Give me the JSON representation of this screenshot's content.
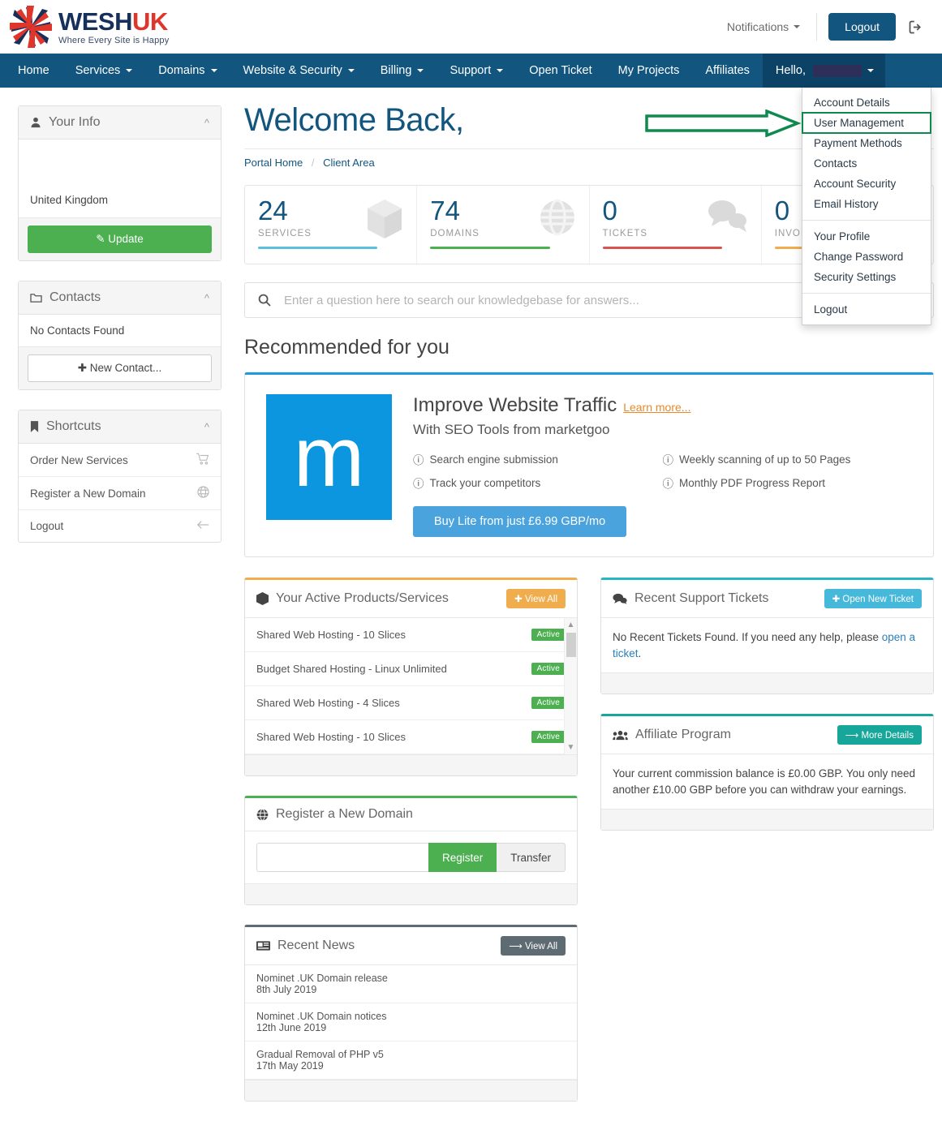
{
  "brand": {
    "name_main": "WESH",
    "name_accent": "UK",
    "tagline": "Where Every Site is Happy",
    "color_navy": "#16305c",
    "color_red": "#e0352b"
  },
  "header": {
    "notifications_label": "Notifications",
    "logout_label": "Logout",
    "logout_icon": "sign-out-icon"
  },
  "nav": {
    "items": [
      {
        "label": "Home",
        "caret": false
      },
      {
        "label": "Services",
        "caret": true
      },
      {
        "label": "Domains",
        "caret": true
      },
      {
        "label": "Website & Security",
        "caret": true
      },
      {
        "label": "Billing",
        "caret": true
      },
      {
        "label": "Support",
        "caret": true
      },
      {
        "label": "Open Ticket",
        "caret": false
      },
      {
        "label": "My Projects",
        "caret": false
      },
      {
        "label": "Affiliates",
        "caret": false
      }
    ],
    "user_label": "Hello,",
    "user_name_redacted": true,
    "accent": "#12557e",
    "accent_active": "#0c4265"
  },
  "user_dropdown": {
    "group1": [
      "Account Details",
      "User Management",
      "Payment Methods",
      "Contacts",
      "Account Security",
      "Email History"
    ],
    "group2": [
      "Your Profile",
      "Change Password",
      "Security Settings"
    ],
    "group3": [
      "Logout"
    ],
    "highlighted": "User Management",
    "annotation_color": "#0f8a4f"
  },
  "page": {
    "welcome": "Welcome Back,",
    "breadcrumb": {
      "home": "Portal Home",
      "sep": "/",
      "current": "Client Area"
    }
  },
  "stats": [
    {
      "value": "24",
      "label": "SERVICES",
      "color": "#5bc0de",
      "icon": "box-icon"
    },
    {
      "value": "74",
      "label": "DOMAINS",
      "color": "#4caf50",
      "icon": "globe-icon"
    },
    {
      "value": "0",
      "label": "TICKETS",
      "color": "#d9534f",
      "icon": "comments-icon"
    },
    {
      "value": "0",
      "label": "INVOICES",
      "color": "#f0ad4e",
      "icon": "invoice-icon"
    }
  ],
  "search": {
    "placeholder": "Enter a question here to search our knowledgebase for answers...",
    "value": "",
    "icon": "search-icon"
  },
  "recommended": {
    "section_title": "Recommended for you",
    "logo_letter": "m",
    "logo_color": "#0d96e0",
    "title": "Improve Website Traffic",
    "learn_more": "Learn more...",
    "subtitle": "With SEO Tools from marketgoo",
    "features": [
      "Search engine submission",
      "Weekly scanning of up to 50 Pages",
      "Track your competitors",
      "Monthly PDF Progress Report"
    ],
    "buy_label": "Buy Lite from just £6.99 GBP/mo"
  },
  "sidebar": {
    "your_info": {
      "title": "Your Info",
      "icon": "user-icon",
      "country": "United Kingdom",
      "update_label": "Update",
      "update_icon": "pencil-icon",
      "collapse_icon": "chevron-up-icon"
    },
    "contacts": {
      "title": "Contacts",
      "icon": "folder-icon",
      "empty_text": "No Contacts Found",
      "new_label": "New Contact...",
      "new_icon": "plus-icon",
      "collapse_icon": "chevron-up-icon"
    },
    "shortcuts": {
      "title": "Shortcuts",
      "icon": "bookmark-icon",
      "collapse_icon": "chevron-up-icon",
      "items": [
        {
          "label": "Order New Services",
          "icon": "cart-icon"
        },
        {
          "label": "Register a New Domain",
          "icon": "globe-icon"
        },
        {
          "label": "Logout",
          "icon": "arrow-left-icon"
        }
      ]
    }
  },
  "services_panel": {
    "title": "Your Active Products/Services",
    "icon": "box-icon",
    "button_label": "View All",
    "button_icon": "plus-icon",
    "rows": [
      {
        "name": "Shared Web Hosting - 10 Slices",
        "status": "Active"
      },
      {
        "name": "Budget Shared Hosting - Linux Unlimited",
        "status": "Active"
      },
      {
        "name": "Shared Web Hosting - 4 Slices",
        "status": "Active"
      },
      {
        "name": "Shared Web Hosting - 10 Slices",
        "status": "Active"
      }
    ],
    "scrollbar_up_icon": "chevron-up-icon",
    "scrollbar_down_icon": "chevron-down-icon"
  },
  "domain_panel": {
    "title": "Register a New Domain",
    "icon": "globe-icon",
    "input_value": "",
    "input_placeholder": "",
    "register_label": "Register",
    "transfer_label": "Transfer"
  },
  "news_panel": {
    "title": "Recent News",
    "icon": "newspaper-icon",
    "button_label": "View All",
    "button_icon": "arrow-right-icon",
    "items": [
      {
        "title": "Nominet .UK Domain release",
        "date": "8th July 2019"
      },
      {
        "title": "Nominet .UK Domain notices",
        "date": "12th June 2019"
      },
      {
        "title": "Gradual Removal of PHP v5",
        "date": "17th May 2019"
      }
    ]
  },
  "tickets_panel": {
    "title": "Recent Support Tickets",
    "icon": "comments-icon",
    "button_label": "Open New Ticket",
    "button_icon": "plus-icon",
    "body_pre": "No Recent Tickets Found. If you need any help, please ",
    "body_link": "open a ticket",
    "body_post": "."
  },
  "affiliate_panel": {
    "title": "Affiliate Program",
    "icon": "users-icon",
    "button_label": "More Details",
    "button_icon": "arrow-right-icon",
    "body": "Your current commission balance is £0.00 GBP. You only need another £10.00 GBP before you can withdraw your earnings."
  }
}
